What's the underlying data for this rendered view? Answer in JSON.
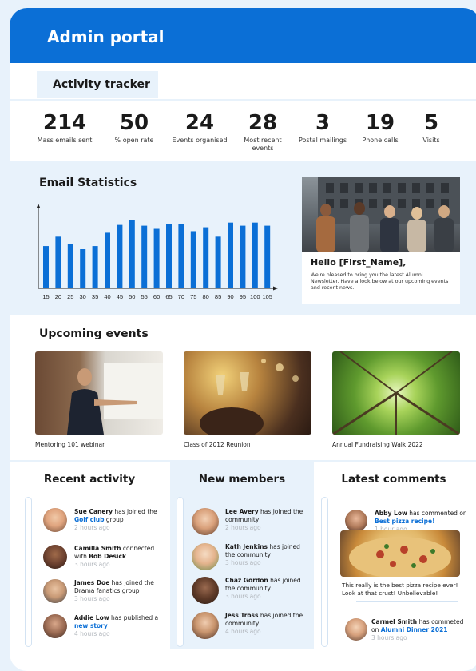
{
  "header": {
    "title": "Admin portal"
  },
  "tracker": {
    "tab_label": "Activity tracker",
    "stats": [
      {
        "value": "214",
        "label": "Mass emails sent"
      },
      {
        "value": "50",
        "label": "% open rate"
      },
      {
        "value": "24",
        "label": "Events organised"
      },
      {
        "value": "28",
        "label": "Most recent events"
      },
      {
        "value": "3",
        "label": "Postal mailings"
      },
      {
        "value": "19",
        "label": "Phone calls"
      },
      {
        "value": "5",
        "label": "Visits"
      }
    ]
  },
  "email_stats": {
    "title": "Email Statistics"
  },
  "chart_data": {
    "type": "bar",
    "title": "Email Statistics",
    "categories": [
      "15",
      "20",
      "25",
      "30",
      "35",
      "40",
      "45",
      "50",
      "55",
      "60",
      "65",
      "70",
      "75",
      "80",
      "85",
      "90",
      "95",
      "100",
      "105"
    ],
    "values": [
      54,
      66,
      57,
      50,
      54,
      71,
      81,
      87,
      80,
      76,
      82,
      82,
      73,
      78,
      66,
      84,
      80,
      84,
      80
    ],
    "ylim": [
      0,
      100
    ],
    "grid": false,
    "colors": {
      "bar": "#0b6fd6",
      "axis": "#222222"
    }
  },
  "newsletter": {
    "greeting": "Hello [First_Name],",
    "body": "We're pleased to bring you the latest Alumni Newsletter. Have a look below at our upcoming events and recent news."
  },
  "events": {
    "title": "Upcoming events",
    "items": [
      {
        "caption": "Mentoring 101 webinar"
      },
      {
        "caption": "Class of 2012 Reunion"
      },
      {
        "caption": "Annual Fundraising Walk 2022"
      }
    ]
  },
  "recent_activity": {
    "title": "Recent activity",
    "items": [
      {
        "name": "Sue Canery",
        "pre": " has joined the ",
        "link": "Golf club",
        "post": " group",
        "time": "2 hours ago"
      },
      {
        "name": "Camilla Smith",
        "pre": " connected with ",
        "bold2": "Bob Desick",
        "time": "3 hours ago"
      },
      {
        "name": "James Doe",
        "pre": " has joined the Drama fanatics group",
        "time": "3 hours ago"
      },
      {
        "name": "Addie Low",
        "pre": " has published a ",
        "link": "new story",
        "time": "4 hours ago"
      }
    ]
  },
  "new_members": {
    "title": "New members",
    "items": [
      {
        "name": "Lee Avery",
        "pre": " has joined the community",
        "time": "2 hours ago"
      },
      {
        "name": "Kath Jenkins",
        "pre": " has joined the community",
        "time": "3 hours ago"
      },
      {
        "name": "Chaz Gordon",
        "pre": " has joined the community",
        "time": "3 hours ago"
      },
      {
        "name": "Jess Tross",
        "pre": " has joined the community",
        "time": "4 hours ago"
      }
    ]
  },
  "latest_comments": {
    "title": "Latest comments",
    "items": [
      {
        "name": "Abby Low",
        "pre": " has commented on ",
        "link": "Best pizza recipe!",
        "time": "1 hour ago"
      },
      {
        "name": "Carmel Smith",
        "pre": " has commeted on ",
        "link": "Alumni Dinner 2021",
        "time": "3 hours ago"
      }
    ],
    "comment_text": "This really is the best pizza recipe ever! Look at that crust! Unbelievable!"
  },
  "colors": {
    "brand": "#0b6fd6",
    "panel": "#e8f2fb",
    "muted": "#b0b5bb"
  }
}
